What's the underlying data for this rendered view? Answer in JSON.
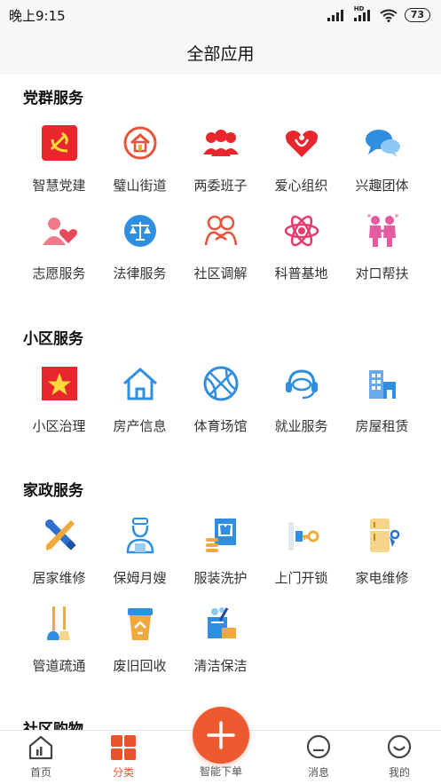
{
  "status_bar": {
    "time": "晚上9:15",
    "battery": "73",
    "signal_badge": "HD"
  },
  "header": {
    "title": "全部应用"
  },
  "sections": [
    {
      "title": "党群服务",
      "items": [
        {
          "label": "智慧党建",
          "icon": "party-emblem-icon"
        },
        {
          "label": "璧山街道",
          "icon": "house-circle-icon"
        },
        {
          "label": "两委班子",
          "icon": "group-people-icon"
        },
        {
          "label": "爱心组织",
          "icon": "heart-hands-icon"
        },
        {
          "label": "兴趣团体",
          "icon": "chat-bubbles-icon"
        },
        {
          "label": "志愿服务",
          "icon": "person-heart-icon"
        },
        {
          "label": "法律服务",
          "icon": "scales-icon"
        },
        {
          "label": "社区调解",
          "icon": "handshake-people-icon"
        },
        {
          "label": "科普基地",
          "icon": "atom-icon"
        },
        {
          "label": "对口帮扶",
          "icon": "couple-icon"
        }
      ]
    },
    {
      "title": "小区服务",
      "items": [
        {
          "label": "小区治理",
          "icon": "star-flag-icon"
        },
        {
          "label": "房产信息",
          "icon": "home-outline-icon"
        },
        {
          "label": "体育场馆",
          "icon": "basketball-icon"
        },
        {
          "label": "就业服务",
          "icon": "headset-icon"
        },
        {
          "label": "房屋租赁",
          "icon": "building-icon"
        }
      ]
    },
    {
      "title": "家政服务",
      "items": [
        {
          "label": "居家维修",
          "icon": "tools-icon"
        },
        {
          "label": "保姆月嫂",
          "icon": "nanny-icon"
        },
        {
          "label": "服装洗护",
          "icon": "washer-icon"
        },
        {
          "label": "上门开锁",
          "icon": "key-lock-icon"
        },
        {
          "label": "家电维修",
          "icon": "fridge-wrench-icon"
        },
        {
          "label": "管道疏通",
          "icon": "plunger-icon"
        },
        {
          "label": "废旧回收",
          "icon": "recycle-bin-icon"
        },
        {
          "label": "清洁保洁",
          "icon": "cleaning-bucket-icon"
        }
      ]
    },
    {
      "title": "社区购物",
      "items": []
    }
  ],
  "tabbar": {
    "items": [
      {
        "label": "首页",
        "icon": "home-chart-icon"
      },
      {
        "label": "分类",
        "icon": "category-grid-icon"
      },
      {
        "label": "智能下单",
        "icon": "plus-icon"
      },
      {
        "label": "消息",
        "icon": "message-icon"
      },
      {
        "label": "我的",
        "icon": "smile-icon"
      }
    ]
  },
  "colors": {
    "accent": "#ee5a30",
    "red": "#e8262d",
    "blue": "#2f8ee0",
    "pink": "#e63c6e"
  }
}
